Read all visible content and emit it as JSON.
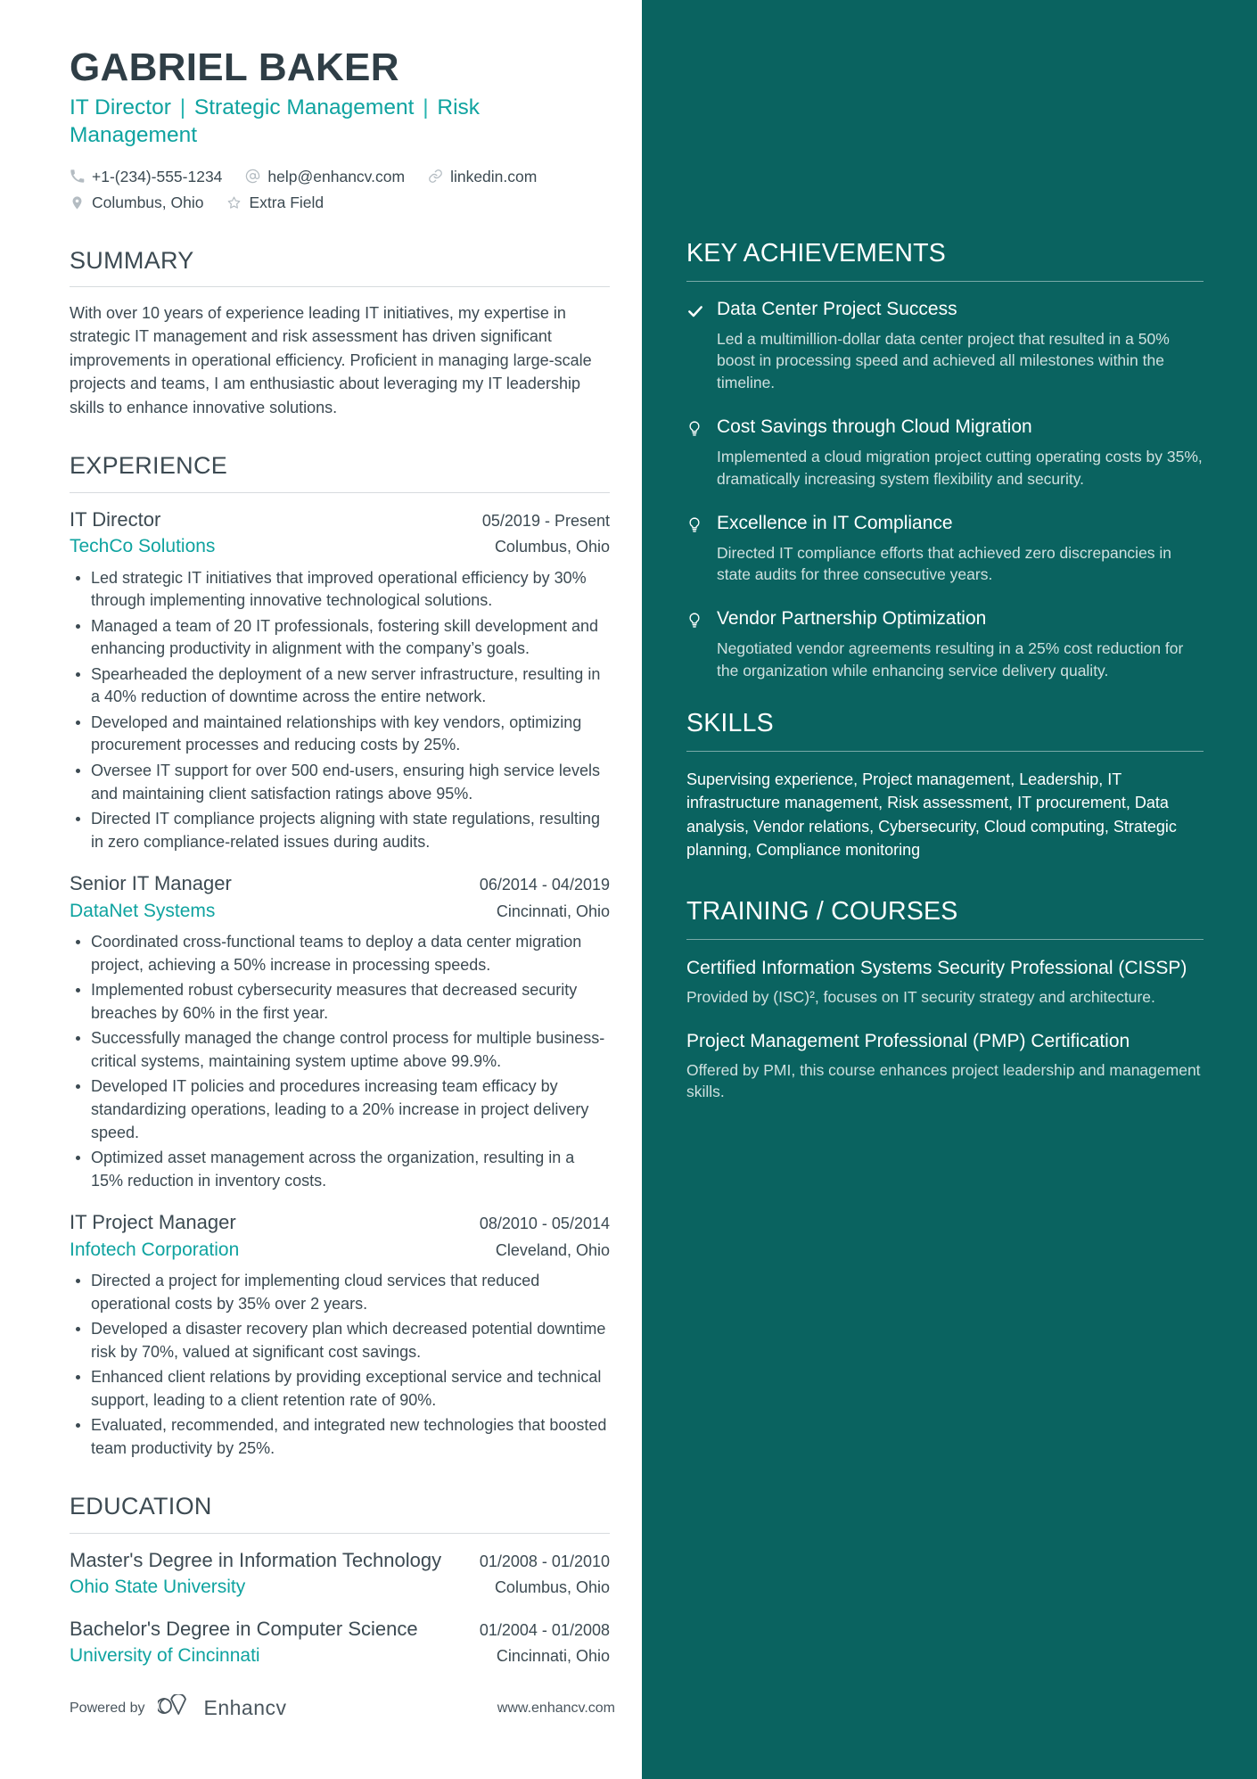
{
  "colors": {
    "accent": "#0fa3a0",
    "sidebar_bg": "#0a6360",
    "text": "#3c4a52",
    "heading": "#2f3e46"
  },
  "header": {
    "name": "GABRIEL BAKER",
    "headline_parts": [
      "IT Director",
      "Strategic Management",
      "Risk Management"
    ],
    "headline_separator": "|",
    "contacts": [
      {
        "icon": "phone-icon",
        "text": "+1-(234)-555-1234"
      },
      {
        "icon": "at-sign-icon",
        "text": "help@enhancv.com"
      },
      {
        "icon": "link-icon",
        "text": "linkedin.com"
      },
      {
        "icon": "map-pin-icon",
        "text": "Columbus, Ohio"
      },
      {
        "icon": "star-icon",
        "text": "Extra Field"
      }
    ]
  },
  "summary": {
    "heading": "SUMMARY",
    "text": "With over 10 years of experience leading IT initiatives, my expertise in strategic IT management and risk assessment has driven significant improvements in operational efficiency. Proficient in managing large-scale projects and teams, I am enthusiastic about leveraging my IT leadership skills to enhance innovative solutions."
  },
  "experience": {
    "heading": "EXPERIENCE",
    "jobs": [
      {
        "title": "IT Director",
        "dates": "05/2019 - Present",
        "company": "TechCo Solutions",
        "location": "Columbus, Ohio",
        "bullets": [
          "Led strategic IT initiatives that improved operational efficiency by 30% through implementing innovative technological solutions.",
          "Managed a team of 20 IT professionals, fostering skill development and enhancing productivity in alignment with the company’s goals.",
          "Spearheaded the deployment of a new server infrastructure, resulting in a 40% reduction of downtime across the entire network.",
          "Developed and maintained relationships with key vendors, optimizing procurement processes and reducing costs by 25%.",
          "Oversee IT support for over 500 end-users, ensuring high service levels and maintaining client satisfaction ratings above 95%.",
          "Directed IT compliance projects aligning with state regulations, resulting in zero compliance-related issues during audits."
        ]
      },
      {
        "title": "Senior IT Manager",
        "dates": "06/2014 - 04/2019",
        "company": "DataNet Systems",
        "location": "Cincinnati, Ohio",
        "bullets": [
          "Coordinated cross-functional teams to deploy a data center migration project, achieving a 50% increase in processing speeds.",
          "Implemented robust cybersecurity measures that decreased security breaches by 60% in the first year.",
          "Successfully managed the change control process for multiple business-critical systems, maintaining system uptime above 99.9%.",
          "Developed IT policies and procedures increasing team efficacy by standardizing operations, leading to a 20% increase in project delivery speed.",
          "Optimized asset management across the organization, resulting in a 15% reduction in inventory costs."
        ]
      },
      {
        "title": "IT Project Manager",
        "dates": "08/2010 - 05/2014",
        "company": "Infotech Corporation",
        "location": "Cleveland, Ohio",
        "bullets": [
          "Directed a project for implementing cloud services that reduced operational costs by 35% over 2 years.",
          "Developed a disaster recovery plan which decreased potential downtime risk by 70%, valued at significant cost savings.",
          "Enhanced client relations by providing exceptional service and technical support, leading to a client retention rate of 90%.",
          "Evaluated, recommended, and integrated new technologies that boosted team productivity by 25%."
        ]
      }
    ]
  },
  "education": {
    "heading": "EDUCATION",
    "entries": [
      {
        "degree": "Master's Degree in Information Technology",
        "dates": "01/2008 - 01/2010",
        "school": "Ohio State University",
        "location": "Columbus, Ohio"
      },
      {
        "degree": "Bachelor's Degree in Computer Science",
        "dates": "01/2004 - 01/2008",
        "school": "University of Cincinnati",
        "location": "Cincinnati, Ohio"
      }
    ]
  },
  "achievements": {
    "heading": "KEY ACHIEVEMENTS",
    "items": [
      {
        "icon": "check-icon",
        "title": "Data Center Project Success",
        "description": "Led a multimillion-dollar data center project that resulted in a 50% boost in processing speed and achieved all milestones within the timeline."
      },
      {
        "icon": "lightbulb-icon",
        "title": "Cost Savings through Cloud Migration",
        "description": "Implemented a cloud migration project cutting operating costs by 35%, dramatically increasing system flexibility and security."
      },
      {
        "icon": "lightbulb-icon",
        "title": "Excellence in IT Compliance",
        "description": "Directed IT compliance efforts that achieved zero discrepancies in state audits for three consecutive years."
      },
      {
        "icon": "lightbulb-icon",
        "title": "Vendor Partnership Optimization",
        "description": "Negotiated vendor agreements resulting in a 25% cost reduction for the organization while enhancing service delivery quality."
      }
    ]
  },
  "skills": {
    "heading": "SKILLS",
    "text": "Supervising experience, Project management, Leadership, IT infrastructure management, Risk assessment, IT procurement, Data analysis, Vendor relations, Cybersecurity, Cloud computing, Strategic planning, Compliance monitoring"
  },
  "training": {
    "heading": "TRAINING / COURSES",
    "courses": [
      {
        "title": "Certified Information Systems Security Professional (CISSP)",
        "description": "Provided by (ISC)², focuses on IT security strategy and architecture."
      },
      {
        "title": "Project Management Professional (PMP) Certification",
        "description": "Offered by PMI, this course enhances project leadership and management skills."
      }
    ]
  },
  "footer": {
    "powered_by": "Powered by",
    "brand": "Enhancv",
    "website": "www.enhancv.com"
  }
}
